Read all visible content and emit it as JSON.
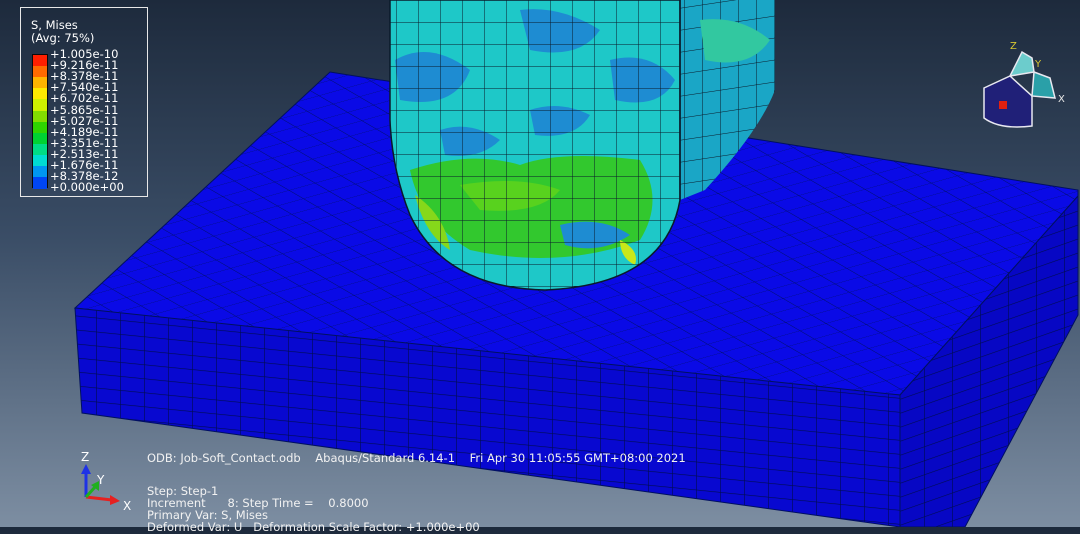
{
  "legend": {
    "title_line1": "S, Mises",
    "title_line2": "(Avg: 75%)",
    "entries": [
      {
        "label": "+1.005e-10",
        "color": "#ff1f00"
      },
      {
        "label": "+9.216e-11",
        "color": "#ff6a00"
      },
      {
        "label": "+8.378e-11",
        "color": "#ffb400"
      },
      {
        "label": "+7.540e-11",
        "color": "#ffea00"
      },
      {
        "label": "+6.702e-11",
        "color": "#cff000"
      },
      {
        "label": "+5.865e-11",
        "color": "#83dd00"
      },
      {
        "label": "+5.027e-11",
        "color": "#2fd400"
      },
      {
        "label": "+4.189e-11",
        "color": "#00d232"
      },
      {
        "label": "+3.351e-11",
        "color": "#00dc86"
      },
      {
        "label": "+2.513e-11",
        "color": "#00dcd2"
      },
      {
        "label": "+1.676e-11",
        "color": "#0096f0"
      },
      {
        "label": "+8.378e-12",
        "color": "#0046f4"
      },
      {
        "label": "+0.000e+00",
        "color": "#0000f0"
      }
    ]
  },
  "footer": {
    "odb_line": "ODB: Job-Soft_Contact.odb    Abaqus/Standard 6.14-1    Fri Apr 30 11:05:55 GMT+08:00 2021",
    "step_line": "Step: Step-1",
    "increment_line": "Increment      8: Step Time =    0.8000",
    "primary_var_line": "Primary Var: S, Mises",
    "deformed_var_line": "Deformed Var: U   Deformation Scale Factor: +1.000e+00"
  },
  "triad": {
    "z": "Z",
    "y": "Y",
    "x": "X"
  },
  "view_triad": {
    "z": "Z",
    "y": "Y",
    "x": "X"
  },
  "colors": {
    "block": "#0a0ae6",
    "block_mesh": "#001060",
    "indenter_cyan": "#1ec8c8",
    "indenter_blue": "#1e8cd2",
    "indenter_green": "#2ec82e"
  }
}
